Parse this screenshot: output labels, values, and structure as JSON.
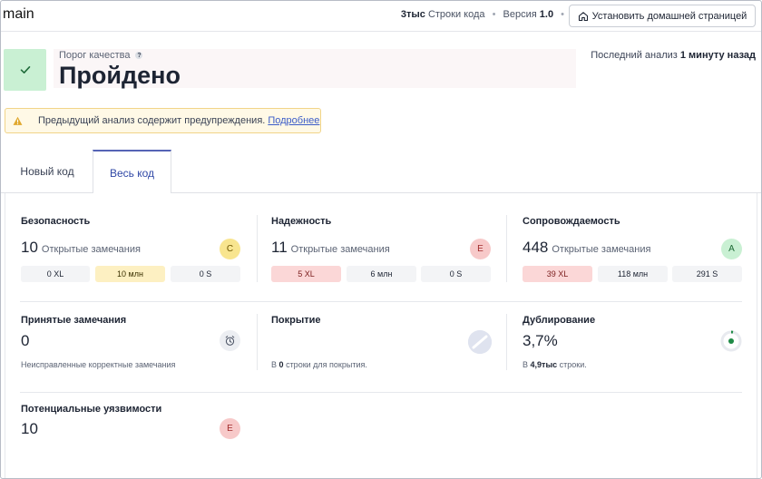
{
  "header": {
    "branch": "main",
    "lines_value": "3тыс",
    "lines_label": "Строки кода",
    "version_label": "Версия",
    "version_value": "1.0",
    "home_button": "Установить домашней страницей"
  },
  "quality_gate": {
    "label": "Порог качества",
    "help": "?",
    "status": "Пройдено",
    "last_analysis_label": "Последний анализ",
    "last_analysis_value": "1 минуту назад"
  },
  "warning": {
    "text": "Предыдущий анализ содержит предупреждения.",
    "link": "Подробнее"
  },
  "tabs": [
    "Новый код",
    "Весь код"
  ],
  "metrics": {
    "security": {
      "title": "Безопасность",
      "count": "10",
      "label": "Открытые замечания",
      "grade": "C",
      "pills": [
        "0 XL",
        "10 млн",
        "0 S"
      ]
    },
    "reliability": {
      "title": "Надежность",
      "count": "11",
      "label": "Открытые замечания",
      "grade": "E",
      "pills": [
        "5 XL",
        "6 млн",
        "0 S"
      ]
    },
    "maintainability": {
      "title": "Сопровождаемость",
      "count": "448",
      "label": "Открытые замечания",
      "grade": "A",
      "pills": [
        "39 XL",
        "118 млн",
        "291 S"
      ]
    },
    "accepted": {
      "title": "Принятые замечания",
      "value": "0",
      "note": "Неисправленные корректные замечания"
    },
    "coverage": {
      "title": "Покрытие",
      "note_pre": "В",
      "note_value": "0",
      "note_post": "строки для покрытия."
    },
    "duplication": {
      "title": "Дублирование",
      "value": "3,7%",
      "note_pre": "В",
      "note_value": "4,9тыс",
      "note_post": "строки."
    },
    "hotspots": {
      "title": "Потенциальные уязвимости",
      "value": "10",
      "grade": "E"
    }
  }
}
